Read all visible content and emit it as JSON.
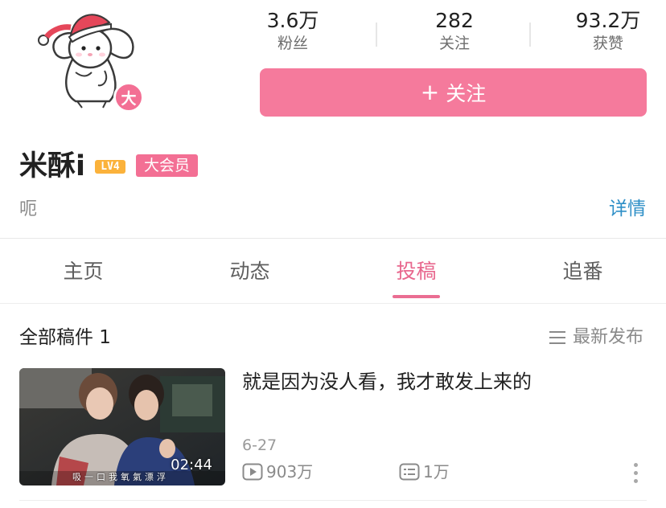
{
  "profile": {
    "avatar_icon": "bunny-santa-hat-avatar",
    "avatar_badge": "大",
    "name": "米酥i",
    "level_badge": "LV4",
    "vip_badge": "大会员",
    "bio": "呃",
    "detail_link": "详情"
  },
  "stats": [
    {
      "value": "3.6万",
      "label": "粉丝"
    },
    {
      "value": "282",
      "label": "关注"
    },
    {
      "value": "93.2万",
      "label": "获赞"
    }
  ],
  "follow_button": {
    "plus": "+",
    "label": "关注"
  },
  "tabs": [
    {
      "label": "主页",
      "active": false
    },
    {
      "label": "动态",
      "active": false
    },
    {
      "label": "投稿",
      "active": true
    },
    {
      "label": "追番",
      "active": false
    }
  ],
  "section": {
    "title": "全部稿件 1",
    "sort_label": "最新发布",
    "sort_icon": "menu-lines-icon"
  },
  "video": {
    "title": "就是因为没人看，我才敢发上来的",
    "duration": "02:44",
    "thumb_subtitle": "吸一口我氧氣漂浮",
    "date": "6-27",
    "plays": "903万",
    "danmaku": "1万",
    "play_icon": "play-count-icon",
    "danmaku_icon": "danmaku-icon",
    "more_icon": "more-vertical-icon"
  },
  "colors": {
    "accent": "#f57a9c",
    "tab_active": "#e8688e",
    "link": "#2e8fc7",
    "level_badge": "#fbb23b"
  }
}
